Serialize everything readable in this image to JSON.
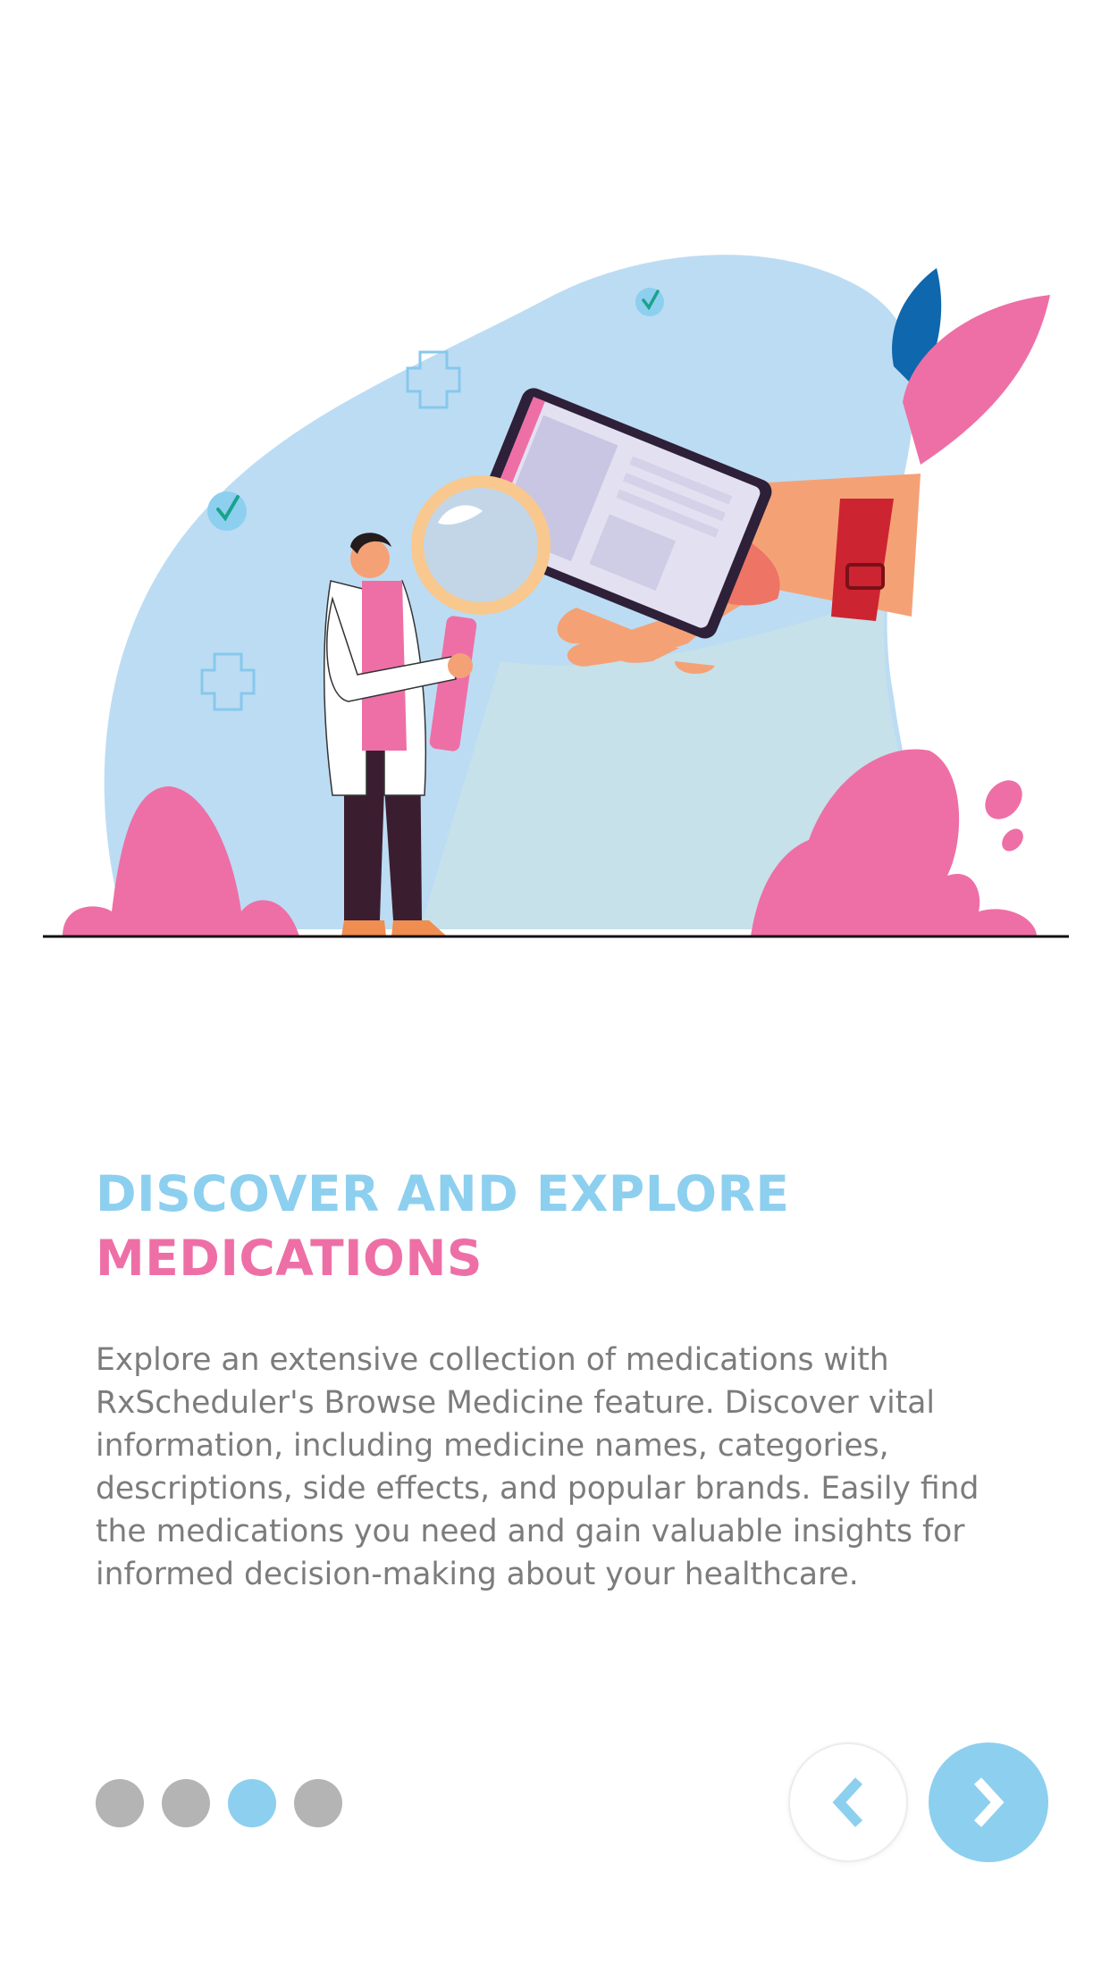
{
  "onboarding": {
    "title_line1": "DISCOVER AND EXPLORE",
    "title_line2": "MEDICATIONS",
    "description": "Explore an extensive collection of medications with RxScheduler's Browse Medicine feature. Discover vital information, including medicine names, categories, descriptions, side effects, and popular brands. Easily find the medications you need and gain valuable insights for informed decision-making about your healthcare."
  },
  "pagination": {
    "total": 4,
    "current": 3
  },
  "navigation": {
    "prev_icon": "chevron-left-icon",
    "next_icon": "chevron-right-icon"
  },
  "colors": {
    "accent_blue": "#8dcfef",
    "accent_pink": "#ee6fa6",
    "text_gray": "#7c7c7c",
    "inactive_dot": "#b4b4b4"
  }
}
